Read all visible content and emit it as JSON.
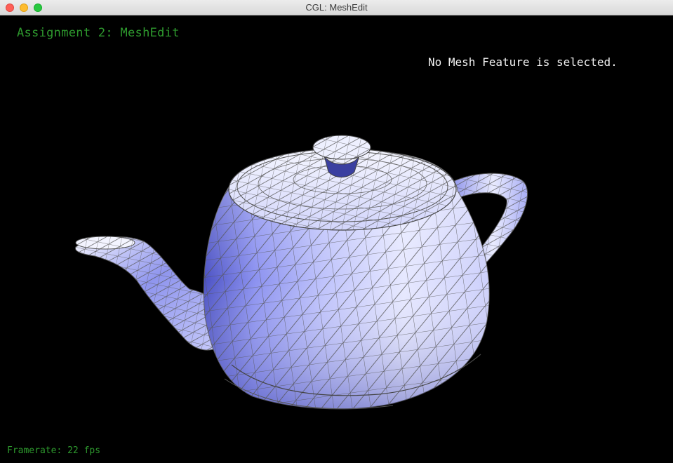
{
  "window": {
    "title": "CGL: MeshEdit",
    "controls": [
      "close",
      "minimize",
      "zoom"
    ]
  },
  "app": {
    "heading": "Assignment 2: MeshEdit",
    "selection_status": "No Mesh Feature is selected.",
    "framerate_label": "Framerate: 22 fps"
  },
  "scene": {
    "model": "teapot",
    "shading_colors": {
      "light": "#f2f3ff",
      "mid": "#b3b8fa",
      "dark": "#5d64d8",
      "wire": "#5a5a5a"
    },
    "text_colors": {
      "heading": "#2e9a2e",
      "status": "#f2f2f2"
    }
  }
}
